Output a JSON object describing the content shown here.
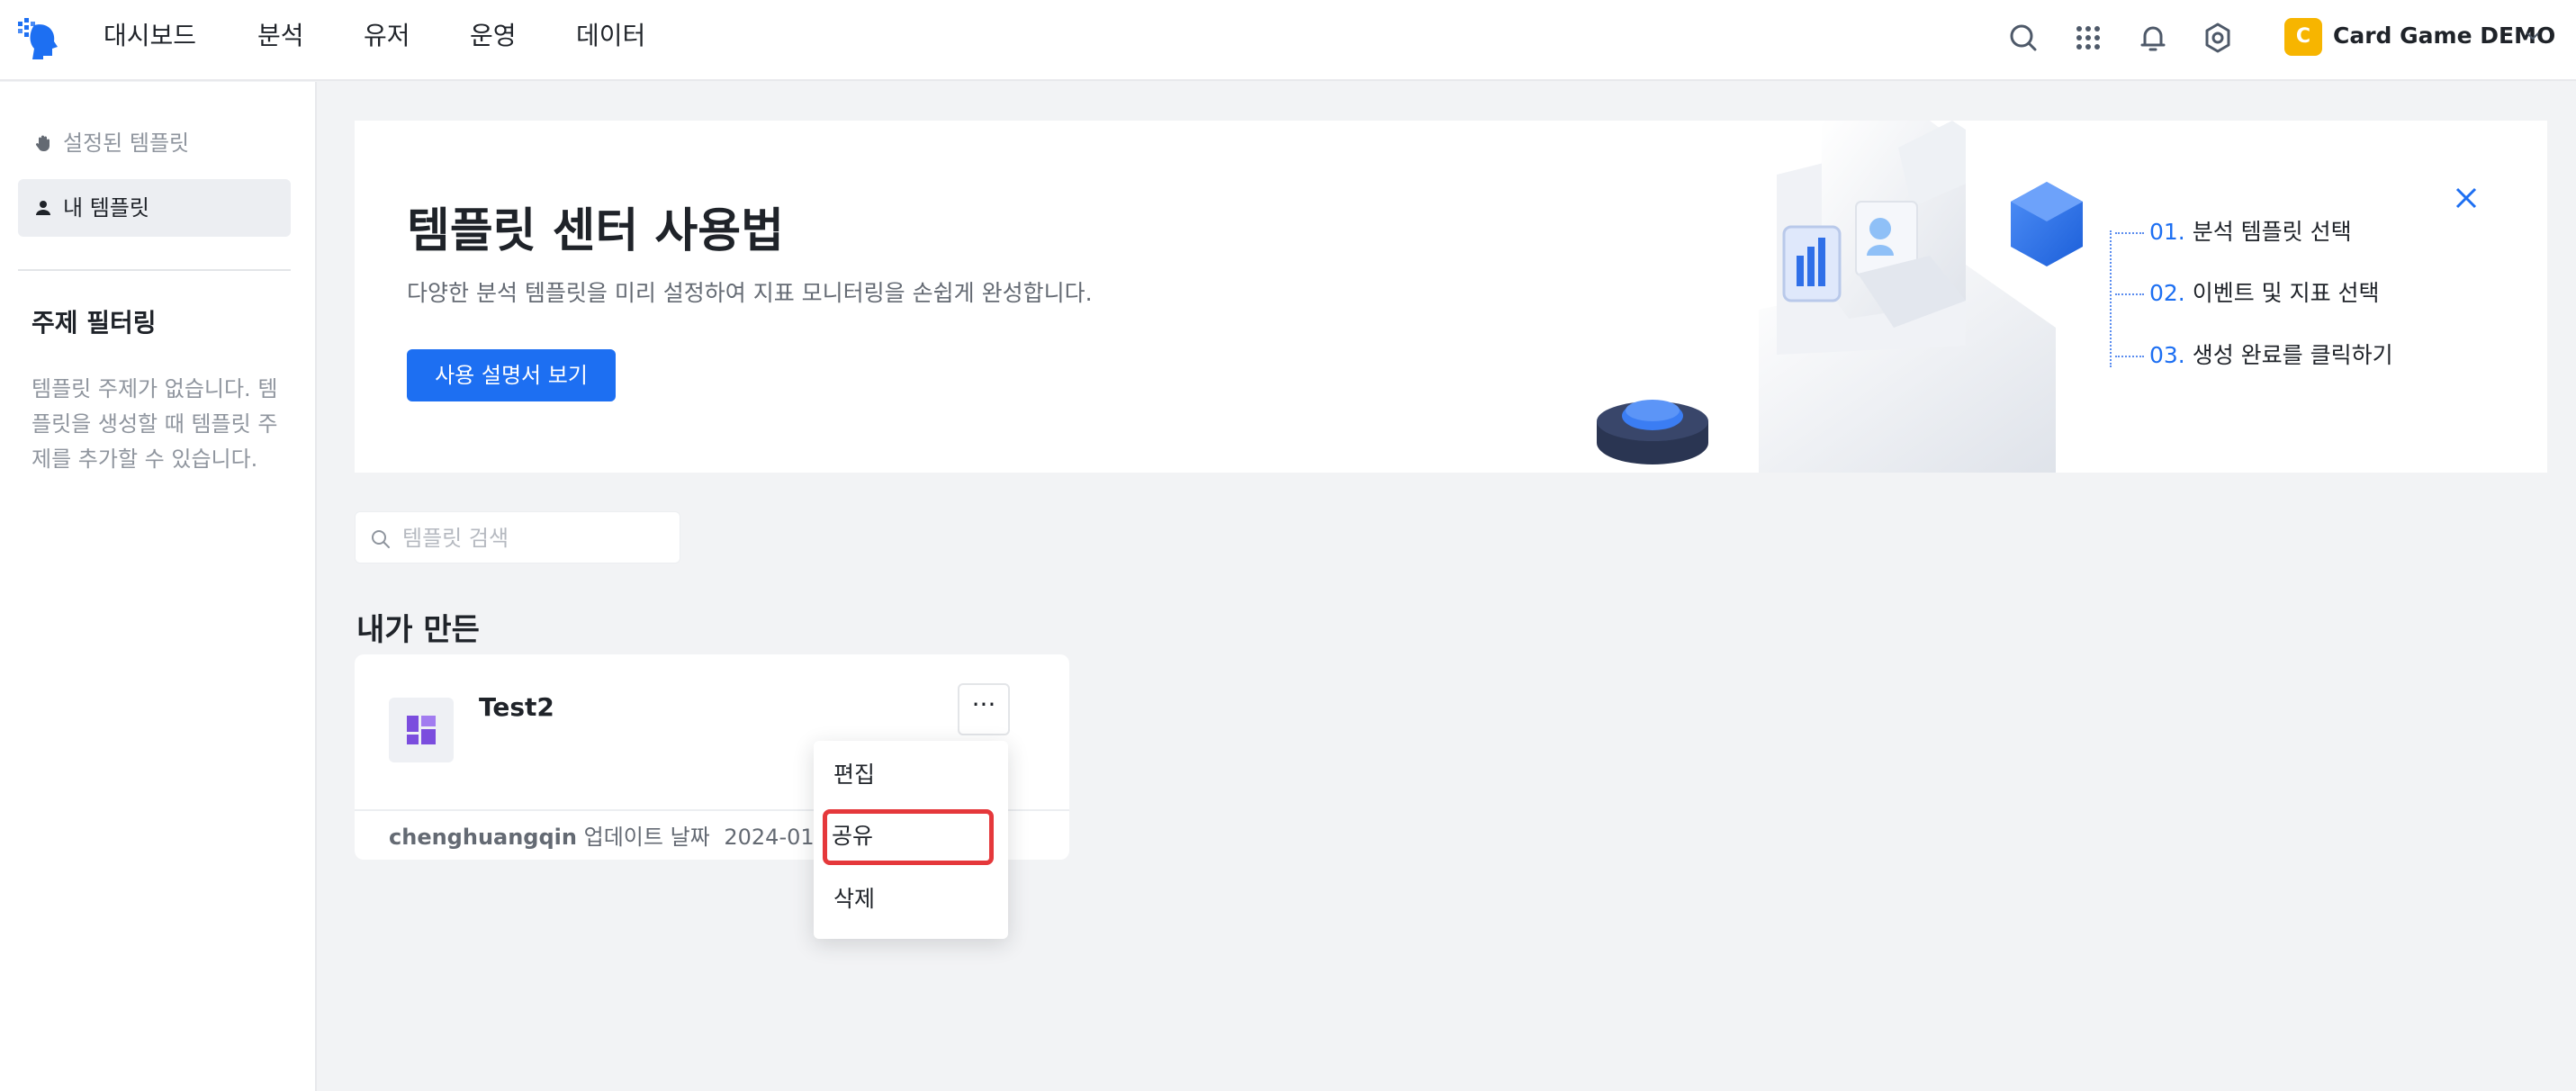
{
  "nav": {
    "items": [
      "대시보드",
      "분석",
      "유저",
      "운영",
      "데이터"
    ]
  },
  "project": {
    "avatar_letter": "C",
    "name": "Card Game DEMO",
    "avatar_color": "#f7b500"
  },
  "sidebar": {
    "items": [
      {
        "label": "설정된 템플릿",
        "icon": "hand-icon"
      },
      {
        "label": "내 템플릿",
        "icon": "user-icon"
      }
    ],
    "filter_heading": "주제 필터링",
    "filter_desc": "템플릿 주제가 없습니다. 템플릿을 생성할 때 템플릿 주제를 추가할 수 있습니다."
  },
  "banner": {
    "title": "템플릿 센터 사용법",
    "desc": "다양한 분석 템플릿을 미리 설정하여 지표 모니터링을 손쉽게 완성합니다.",
    "button": "사용 설명서 보기",
    "steps": [
      {
        "num": "01.",
        "label": "분석 템플릿 선택"
      },
      {
        "num": "02.",
        "label": "이벤트 및 지표 선택"
      },
      {
        "num": "03.",
        "label": "생성 완료를 클릭하기"
      }
    ]
  },
  "search": {
    "placeholder": "템플릿 검색",
    "value": ""
  },
  "section": {
    "title": "내가 만든"
  },
  "card": {
    "title": "Test2",
    "more": "···",
    "author": "chenghuangqin",
    "updated_label": "업데이트 날짜",
    "date": "2024-01-15"
  },
  "menu": {
    "items": [
      "편집",
      "공유",
      "삭제"
    ],
    "highlighted": "공유"
  },
  "colors": {
    "primary": "#1d6ff2",
    "highlight": "#e5383b"
  }
}
